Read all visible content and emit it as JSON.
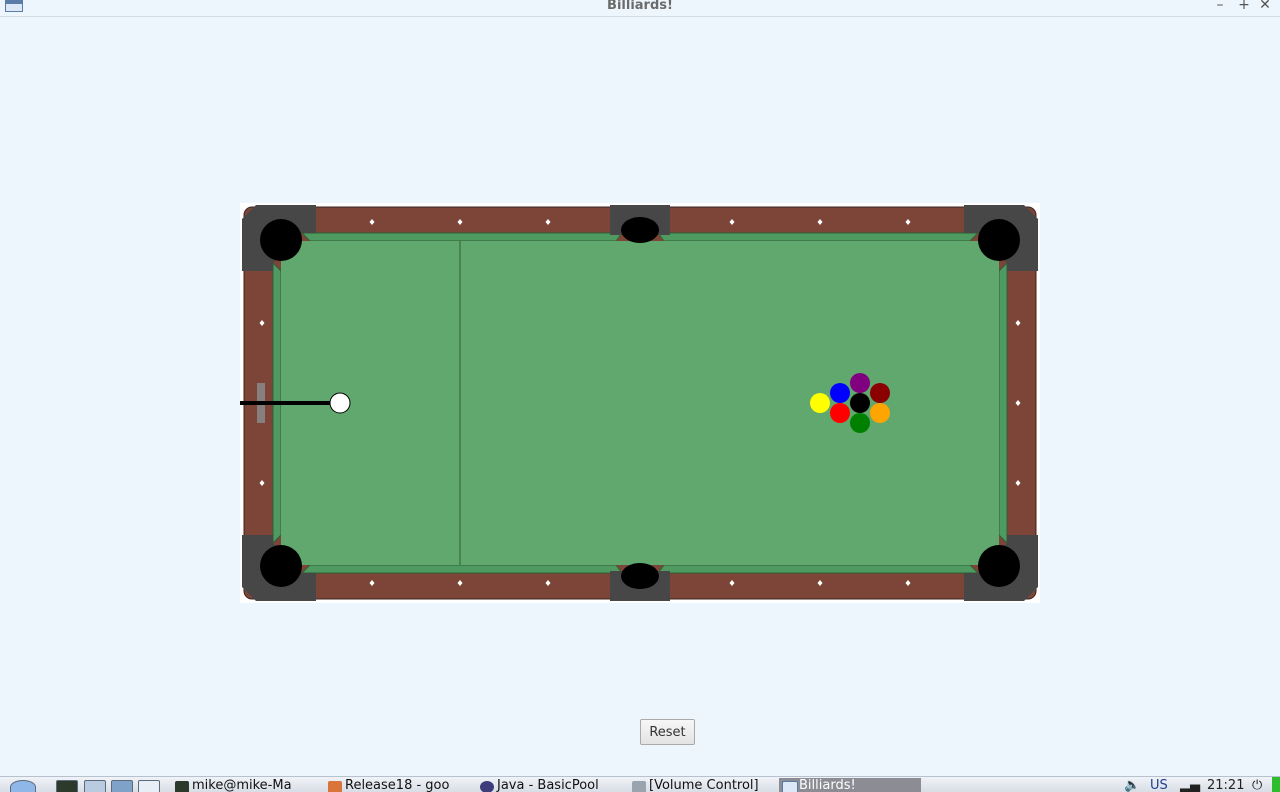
{
  "window": {
    "title": "Billiards!",
    "controls": [
      "–",
      "+",
      "✕"
    ]
  },
  "table": {
    "colors": {
      "felt": "#61a86e",
      "rail_cushion": "#4f9a60",
      "rail_wood": "#7c4538",
      "pocket_frame": "#474747",
      "pocket": "#000000",
      "diamond": "#ffffff",
      "background": "#eef6fd"
    }
  },
  "balls": [
    {
      "name": "cue-ball",
      "color": "#ffffff"
    },
    {
      "name": "ball-yellow",
      "color": "#ffff00"
    },
    {
      "name": "ball-blue",
      "color": "#0000ff"
    },
    {
      "name": "ball-red",
      "color": "#ff0000"
    },
    {
      "name": "ball-purple",
      "color": "#800080"
    },
    {
      "name": "ball-black",
      "color": "#000000"
    },
    {
      "name": "ball-green",
      "color": "#008000"
    },
    {
      "name": "ball-maroon",
      "color": "#8b0000"
    },
    {
      "name": "ball-orange",
      "color": "#ffa500"
    }
  ],
  "controls": {
    "reset_label": "Reset"
  },
  "taskbar": {
    "tasks": [
      {
        "label": "mike@mike-Ma",
        "icon": "terminal-icon"
      },
      {
        "label": "Release18 - goo",
        "icon": "browser-icon"
      },
      {
        "label": "Java - BasicPool",
        "icon": "eclipse-icon"
      },
      {
        "label": "[Volume Control]",
        "icon": "volume-control-icon"
      },
      {
        "label": "Billiards!",
        "icon": "window-icon",
        "active": true
      }
    ],
    "keyboard_layout": "US",
    "clock": "21:21"
  }
}
